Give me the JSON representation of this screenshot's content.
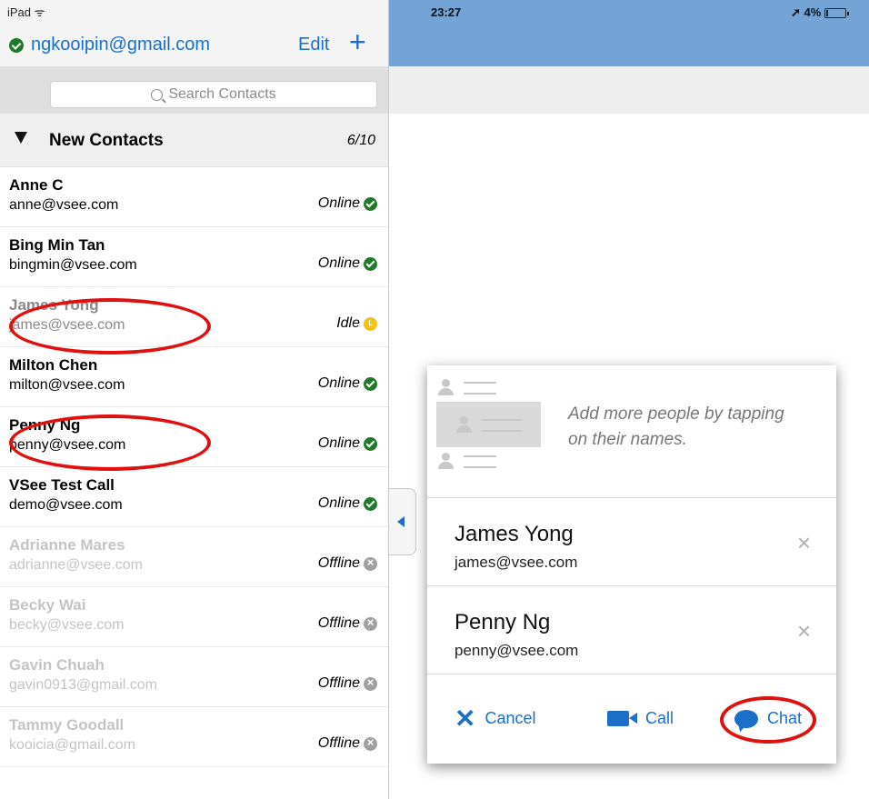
{
  "status_bar": {
    "device": "iPad ᯤ",
    "time": "23:27",
    "battery": "➚ 4%"
  },
  "account": {
    "email": "ngkooipin@gmail.com",
    "edit_label": "Edit",
    "add_label": "+"
  },
  "search": {
    "placeholder": "Search Contacts"
  },
  "group": {
    "name": "New Contacts",
    "count": "6/10"
  },
  "contacts": [
    {
      "name": "Anne C",
      "email": "anne@vsee.com",
      "status": "Online"
    },
    {
      "name": "Bing Min Tan",
      "email": "bingmin@vsee.com",
      "status": "Online"
    },
    {
      "name": "James Yong",
      "email": "james@vsee.com",
      "status": "Idle"
    },
    {
      "name": "Milton Chen",
      "email": "milton@vsee.com",
      "status": "Online"
    },
    {
      "name": "Penny Ng",
      "email": "penny@vsee.com",
      "status": "Online"
    },
    {
      "name": "VSee Test Call",
      "email": "demo@vsee.com",
      "status": "Online"
    },
    {
      "name": "Adrianne Mares",
      "email": "adrianne@vsee.com",
      "status": "Offline"
    },
    {
      "name": "Becky Wai",
      "email": "becky@vsee.com",
      "status": "Offline"
    },
    {
      "name": "Gavin Chuah",
      "email": "gavin0913@gmail.com",
      "status": "Offline"
    },
    {
      "name": "Tammy Goodall",
      "email": "kooicia@gmail.com",
      "status": "Offline"
    }
  ],
  "popover": {
    "hint_line1": "Add more people by tapping",
    "hint_line2": "on their names.",
    "selected": [
      {
        "name": "James Yong",
        "email": "james@vsee.com",
        "remove": "×"
      },
      {
        "name": "Penny Ng",
        "email": "penny@vsee.com",
        "remove": "×"
      }
    ],
    "cancel_label": "Cancel",
    "call_label": "Call",
    "chat_label": "Chat"
  },
  "colors": {
    "accent": "#1b6fc8",
    "header_blue": "#74a3d6",
    "online": "#1f7a2a",
    "idle": "#f2c21a",
    "offline": "#a0a0a0",
    "annotation_red": "#e01010"
  }
}
